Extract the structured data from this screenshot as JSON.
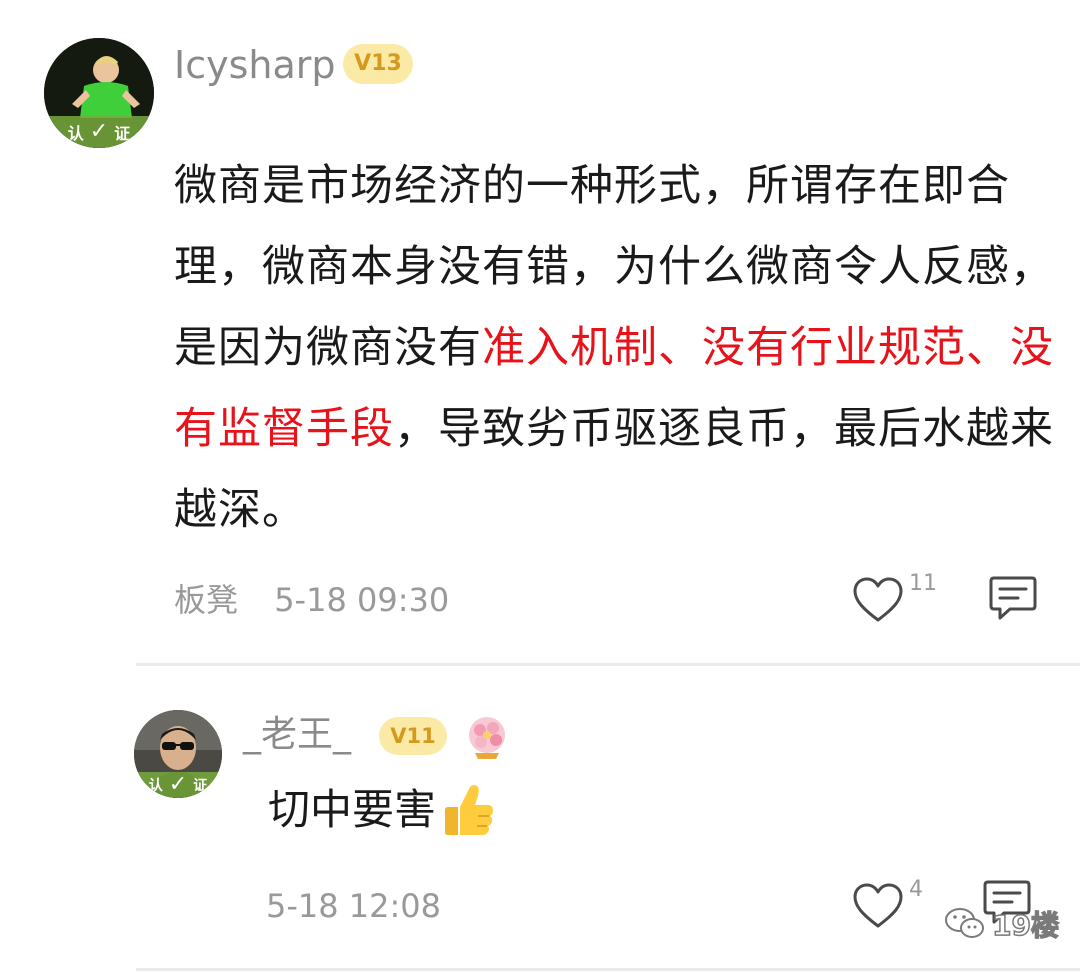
{
  "comment": {
    "username": "Icysharp",
    "level": "V13",
    "verify_label_left": "认",
    "verify_label_right": "证",
    "body_segments": [
      {
        "text": "微商是市场经济的一种形式，所谓存在即合理，微商本身没有错，为什么微商令人反感，是因为微商没有",
        "highlight": false
      },
      {
        "text": "准入机制、没有行业规范、没有监督手段",
        "highlight": true
      },
      {
        "text": "，导致劣币驱逐良币，最后水越来越深。",
        "highlight": false
      }
    ],
    "floor": "板凳",
    "timestamp": "5-18 09:30",
    "like_count": "11"
  },
  "reply": {
    "username": "_老王_",
    "level": "V11",
    "verify_label_left": "认",
    "verify_label_right": "证",
    "text": "切中要害",
    "timestamp": "5-18 12:08",
    "like_count": "4"
  },
  "watermark": {
    "text": "19楼"
  },
  "colors": {
    "highlight": "#e8121b",
    "meta": "#999999",
    "badge_bg": "#fbeaa6",
    "badge_text": "#d59a1d"
  },
  "icons": [
    "heart-outline-icon",
    "comment-icon",
    "thumbs-up-emoji",
    "medal-icon",
    "wechat-icon"
  ]
}
